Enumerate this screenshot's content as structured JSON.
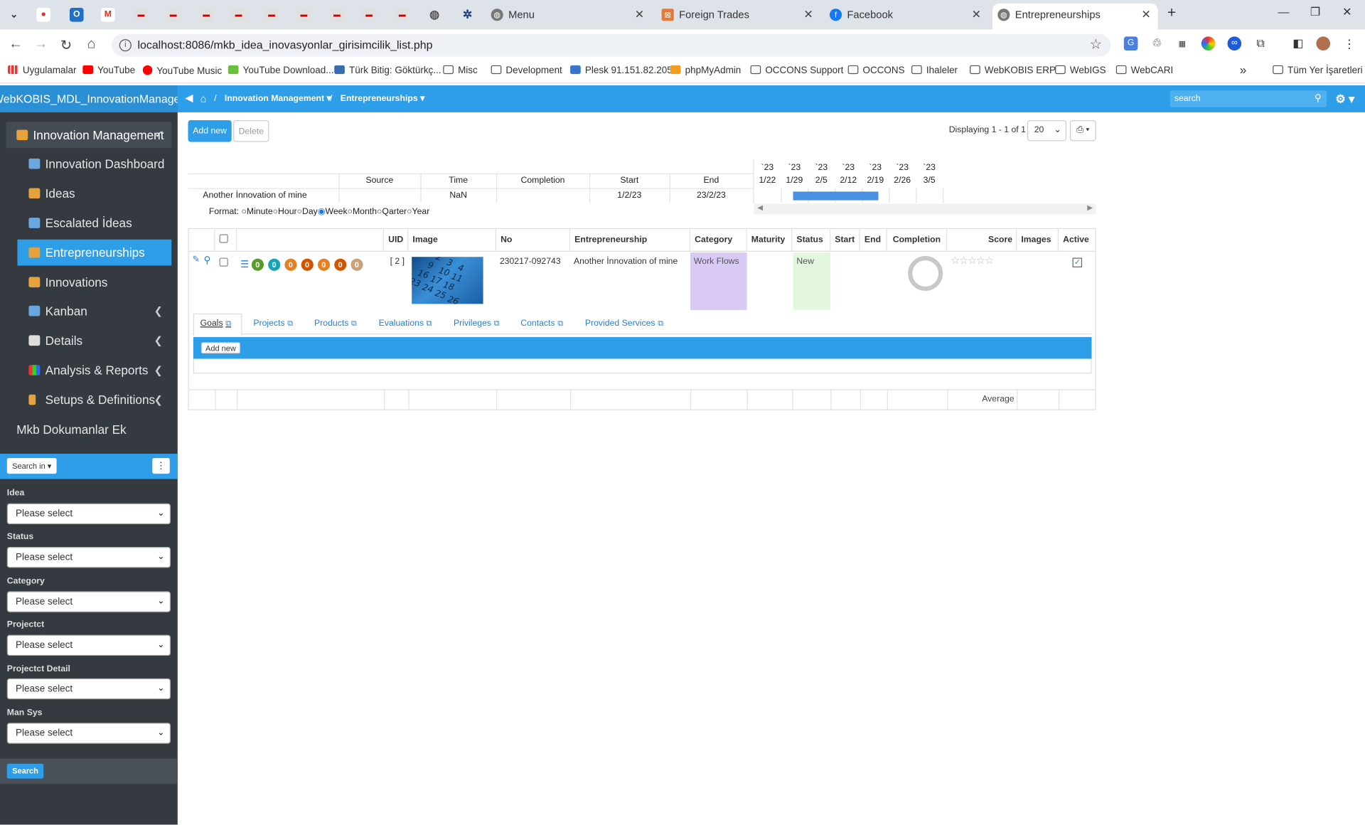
{
  "browser": {
    "tabs": [
      {
        "label": "Menu"
      },
      {
        "label": "Foreign Trades"
      },
      {
        "label": "Facebook"
      },
      {
        "label": "Entrepreneurships"
      }
    ],
    "url": "localhost:8086/mkb_idea_inovasyonlar_girisimcilik_list.php",
    "bookmarks": [
      "Uygulamalar",
      "YouTube",
      "YouTube Music",
      "YouTube Download...",
      "Türk Bitig: Göktürkç...",
      "Misc",
      "Development",
      "Plesk 91.151.82.205",
      "phpMyAdmin",
      "OCCONS Support",
      "OCCONS",
      "Ihaleler",
      "WebKOBIS ERP",
      "WebIGS",
      "WebCARI"
    ],
    "more_bookmarks": "»",
    "all_bookmarks": "Tüm Yer İşaretleri"
  },
  "app": {
    "brand": "WebKOBIS_MDL_InnovationManageme",
    "breadcrumb": [
      "Innovation Management",
      "Entrepreneurships"
    ],
    "search_placeholder": "search"
  },
  "sidebar": {
    "section": "Innovation Management",
    "items": [
      {
        "label": "Innovation Dashboard",
        "has_arrow": false
      },
      {
        "label": "Ideas",
        "has_arrow": false
      },
      {
        "label": "Escalated İdeas",
        "has_arrow": false
      },
      {
        "label": "Entrepreneurships",
        "has_arrow": false,
        "active": true
      },
      {
        "label": "Innovations",
        "has_arrow": false
      },
      {
        "label": "Kanban",
        "has_arrow": true
      },
      {
        "label": "Details",
        "has_arrow": true
      },
      {
        "label": "Analysis & Reports",
        "has_arrow": true
      },
      {
        "label": "Setups & Definitions",
        "has_arrow": true
      }
    ],
    "extra": "Mkb Dokumanlar Ek",
    "search_in": "Search in",
    "filters": [
      {
        "label": "Idea",
        "value": "Please select"
      },
      {
        "label": "Status",
        "value": "Please select"
      },
      {
        "label": "Category",
        "value": "Please select"
      },
      {
        "label": "Projectct",
        "value": "Please select"
      },
      {
        "label": "Projectct Detail",
        "value": "Please select"
      },
      {
        "label": "Man Sys",
        "value": "Please select"
      }
    ],
    "search_button": "Search"
  },
  "toolbar": {
    "add_new": "Add new",
    "delete": "Delete",
    "displaying": "Displaying 1 - 1 of 1",
    "page_size": "20"
  },
  "gantt": {
    "headers": [
      "Source",
      "Time",
      "Completion",
      "Start",
      "End"
    ],
    "row": {
      "name": "Another İnnovation of mine",
      "time": "NaN",
      "start": "1/2/23",
      "end": "23/2/23"
    },
    "weeks": [
      {
        "year": "`23",
        "day": "1/22"
      },
      {
        "year": "`23",
        "day": "1/29"
      },
      {
        "year": "`23",
        "day": "2/5"
      },
      {
        "year": "`23",
        "day": "2/12"
      },
      {
        "year": "`23",
        "day": "2/19"
      },
      {
        "year": "`23",
        "day": "2/26"
      },
      {
        "year": "`23",
        "day": "3/5"
      }
    ],
    "format_label": "Format:",
    "formats": [
      "Minute",
      "Hour",
      "Day",
      "Week",
      "Month",
      "Qarter",
      "Year"
    ],
    "selected_format": "Week"
  },
  "table": {
    "columns": [
      "UID",
      "Image",
      "No",
      "Entrepreneurship",
      "Category",
      "Maturity",
      "Status",
      "Start",
      "End",
      "Completion",
      "Score",
      "Images",
      "Active"
    ],
    "row": {
      "uid": "[ 2 ]",
      "no": "230217-092743",
      "entrepreneurship": "Another İnnovation of mine",
      "category": "Work Flows",
      "status": "New",
      "badges": [
        "0",
        "0",
        "0",
        "0",
        "0",
        "0",
        "0"
      ],
      "score_stars": 0,
      "active": true
    },
    "subtabs": [
      "Goals",
      "Projects",
      "Products",
      "Evaluations",
      "Privileges",
      "Contacts",
      "Provided Services"
    ],
    "sub_add_new": "Add new",
    "footer_average": "Average"
  },
  "colors": {
    "accent": "#2e9ee8",
    "sidebar": "#343a40",
    "category_bg": "#d9c9f5",
    "status_bg": "#e3f7de"
  }
}
